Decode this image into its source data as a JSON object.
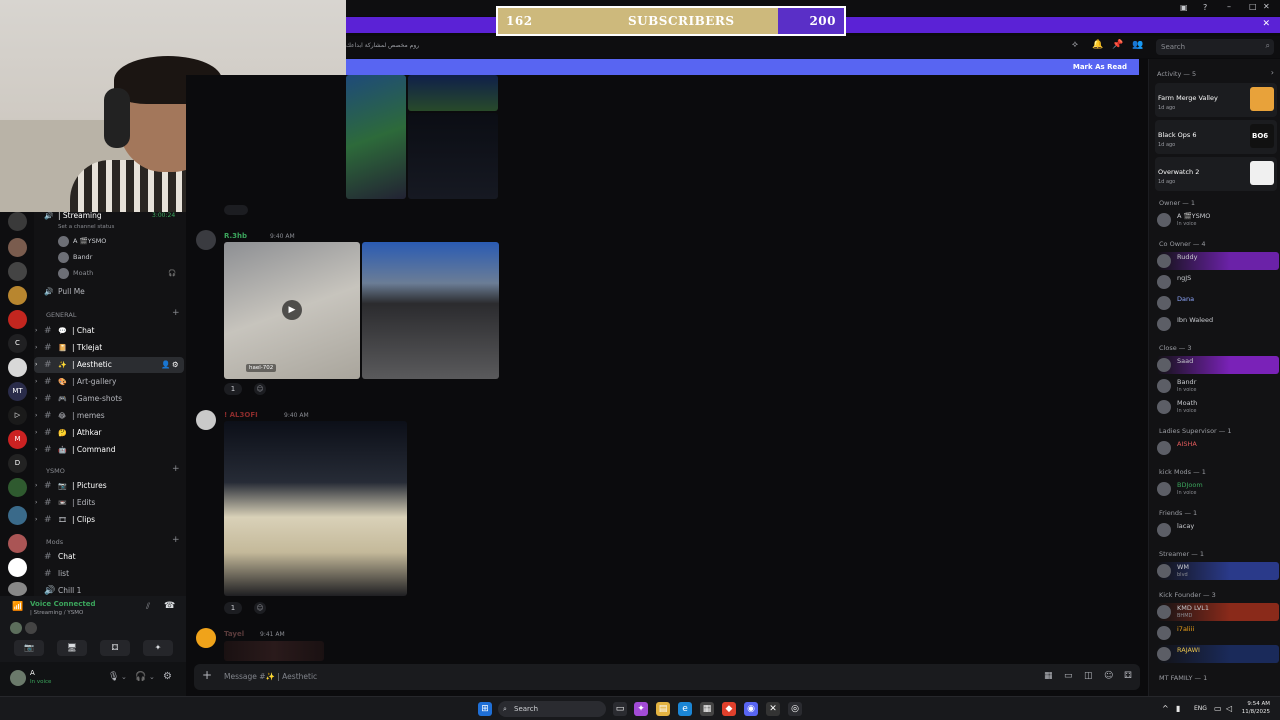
{
  "subscriber_goal": {
    "current": "162",
    "label": "SUBSCRIBERS",
    "target": "200",
    "progress_fraction": 0.81
  },
  "channel_header": {
    "topic": "روم مخصص لمشاركة ابداعك",
    "search_placeholder": "Search"
  },
  "unread_bar": {
    "mark_as_read": "Mark As Read"
  },
  "sidebar": {
    "voice_channel": {
      "name": "| Streaming",
      "timer": "3:00:24",
      "status": "Set a channel status"
    },
    "voice_users": [
      "A 🎬YSMO",
      "Bandr",
      "Moath"
    ],
    "pull_me": "Pull Me",
    "categories": {
      "general": "GENERAL",
      "ysmo": "YSMO",
      "mods": "Mods"
    },
    "general_channels": [
      {
        "icon": "💬",
        "label": "| Chat"
      },
      {
        "icon": "📔",
        "label": "| Tklejat"
      },
      {
        "icon": "✨",
        "label": "| Aesthetic"
      },
      {
        "icon": "🎨",
        "label": "| Art-gallery"
      },
      {
        "icon": "🎮",
        "label": "| Game-shots"
      },
      {
        "icon": "😂",
        "label": "| memes"
      },
      {
        "icon": "🤔",
        "label": "| Athkar"
      },
      {
        "icon": "🤖",
        "label": "| Command"
      }
    ],
    "ysmo_channels": [
      {
        "icon": "📷",
        "label": "| Pictures"
      },
      {
        "icon": "📼",
        "label": "| Edits"
      },
      {
        "icon": "🎞",
        "label": "| Clips"
      }
    ],
    "mods_channels": [
      "Chat",
      "list",
      "Chill 1"
    ]
  },
  "voice_panel": {
    "title": "Voice Connected",
    "subtitle": "| Streaming / YSMO"
  },
  "user_panel": {
    "name": "A",
    "status": "In voice"
  },
  "messages": [
    {
      "author": "R.3hb",
      "time": "9:40 AM",
      "reaction_count": "1",
      "color": "#3ba55c",
      "video_caption": "hael-702"
    },
    {
      "author": "! AL3OFI",
      "time": "9:40 AM",
      "reaction_count": "1",
      "color": "#8a2b2b"
    },
    {
      "author": "Tayel",
      "time": "9:41 AM",
      "color": "#8a2b2b"
    }
  ],
  "composer": {
    "placeholder": "Message #✨ | Aesthetic"
  },
  "right_panel": {
    "activity_title": "Activity — 5",
    "activities": [
      {
        "game": "Farm Merge Valley",
        "ago": "1d ago",
        "thumb_color": "#e8a23a"
      },
      {
        "game": "Black Ops 6",
        "ago": "1d ago",
        "thumb_color": "#111111",
        "thumb_text": "BO6"
      },
      {
        "game": "Overwatch 2",
        "ago": "1d ago",
        "thumb_color": "#f0f0f0"
      }
    ],
    "roles": [
      {
        "title": "Owner — 1",
        "members": [
          {
            "name": "A 🎬YSMO",
            "status": "In voice"
          }
        ]
      },
      {
        "title": "Co Owner — 4",
        "members": [
          {
            "name": "Ruddy"
          },
          {
            "name": "ngJS"
          },
          {
            "name": "Dana"
          },
          {
            "name": "Ibn Waleed"
          }
        ]
      },
      {
        "title": "Close — 3",
        "members": [
          {
            "name": "Saad"
          },
          {
            "name": "Bandr",
            "status": "In voice"
          },
          {
            "name": "Moath",
            "status": "In voice"
          }
        ]
      },
      {
        "title": "Ladies Supervisor — 1",
        "members": [
          {
            "name": "AISHA"
          }
        ]
      },
      {
        "title": "kick Mods — 1",
        "members": [
          {
            "name": "BDJoom",
            "status": "In voice"
          }
        ]
      },
      {
        "title": "Friends — 1",
        "members": [
          {
            "name": "lacay"
          }
        ]
      },
      {
        "title": "Streamer — 1",
        "members": [
          {
            "name": "WM",
            "status": "blvd"
          }
        ]
      },
      {
        "title": "Kick Founder — 3",
        "members": [
          {
            "name": "KMD LVL1",
            "status": "BHMD"
          },
          {
            "name": "i7aliii"
          },
          {
            "name": "RAJAWI"
          }
        ]
      },
      {
        "title": "MT FAMILY — 1",
        "members": []
      }
    ]
  },
  "taskbar": {
    "search": "Search",
    "lang": "ENG",
    "time": "9:54 AM",
    "date": "11/8/2025"
  },
  "colors": {
    "blurple": "#5865f2",
    "purple_band": "#5b22d6",
    "green": "#3ba55c",
    "goal_gold": "#cdb97c"
  }
}
